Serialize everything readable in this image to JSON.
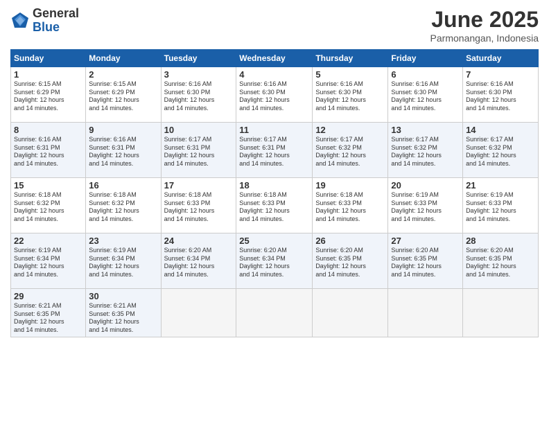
{
  "logo": {
    "general": "General",
    "blue": "Blue"
  },
  "header": {
    "month": "June 2025",
    "location": "Parmonangan, Indonesia"
  },
  "days_of_week": [
    "Sunday",
    "Monday",
    "Tuesday",
    "Wednesday",
    "Thursday",
    "Friday",
    "Saturday"
  ],
  "weeks": [
    [
      {
        "day": "1",
        "sunrise": "6:15 AM",
        "sunset": "6:29 PM",
        "daylight": "12 hours and 14 minutes."
      },
      {
        "day": "2",
        "sunrise": "6:15 AM",
        "sunset": "6:29 PM",
        "daylight": "12 hours and 14 minutes."
      },
      {
        "day": "3",
        "sunrise": "6:16 AM",
        "sunset": "6:30 PM",
        "daylight": "12 hours and 14 minutes."
      },
      {
        "day": "4",
        "sunrise": "6:16 AM",
        "sunset": "6:30 PM",
        "daylight": "12 hours and 14 minutes."
      },
      {
        "day": "5",
        "sunrise": "6:16 AM",
        "sunset": "6:30 PM",
        "daylight": "12 hours and 14 minutes."
      },
      {
        "day": "6",
        "sunrise": "6:16 AM",
        "sunset": "6:30 PM",
        "daylight": "12 hours and 14 minutes."
      },
      {
        "day": "7",
        "sunrise": "6:16 AM",
        "sunset": "6:30 PM",
        "daylight": "12 hours and 14 minutes."
      }
    ],
    [
      {
        "day": "8",
        "sunrise": "6:16 AM",
        "sunset": "6:31 PM",
        "daylight": "12 hours and 14 minutes."
      },
      {
        "day": "9",
        "sunrise": "6:16 AM",
        "sunset": "6:31 PM",
        "daylight": "12 hours and 14 minutes."
      },
      {
        "day": "10",
        "sunrise": "6:17 AM",
        "sunset": "6:31 PM",
        "daylight": "12 hours and 14 minutes."
      },
      {
        "day": "11",
        "sunrise": "6:17 AM",
        "sunset": "6:31 PM",
        "daylight": "12 hours and 14 minutes."
      },
      {
        "day": "12",
        "sunrise": "6:17 AM",
        "sunset": "6:32 PM",
        "daylight": "12 hours and 14 minutes."
      },
      {
        "day": "13",
        "sunrise": "6:17 AM",
        "sunset": "6:32 PM",
        "daylight": "12 hours and 14 minutes."
      },
      {
        "day": "14",
        "sunrise": "6:17 AM",
        "sunset": "6:32 PM",
        "daylight": "12 hours and 14 minutes."
      }
    ],
    [
      {
        "day": "15",
        "sunrise": "6:18 AM",
        "sunset": "6:32 PM",
        "daylight": "12 hours and 14 minutes."
      },
      {
        "day": "16",
        "sunrise": "6:18 AM",
        "sunset": "6:32 PM",
        "daylight": "12 hours and 14 minutes."
      },
      {
        "day": "17",
        "sunrise": "6:18 AM",
        "sunset": "6:33 PM",
        "daylight": "12 hours and 14 minutes."
      },
      {
        "day": "18",
        "sunrise": "6:18 AM",
        "sunset": "6:33 PM",
        "daylight": "12 hours and 14 minutes."
      },
      {
        "day": "19",
        "sunrise": "6:18 AM",
        "sunset": "6:33 PM",
        "daylight": "12 hours and 14 minutes."
      },
      {
        "day": "20",
        "sunrise": "6:19 AM",
        "sunset": "6:33 PM",
        "daylight": "12 hours and 14 minutes."
      },
      {
        "day": "21",
        "sunrise": "6:19 AM",
        "sunset": "6:33 PM",
        "daylight": "12 hours and 14 minutes."
      }
    ],
    [
      {
        "day": "22",
        "sunrise": "6:19 AM",
        "sunset": "6:34 PM",
        "daylight": "12 hours and 14 minutes."
      },
      {
        "day": "23",
        "sunrise": "6:19 AM",
        "sunset": "6:34 PM",
        "daylight": "12 hours and 14 minutes."
      },
      {
        "day": "24",
        "sunrise": "6:20 AM",
        "sunset": "6:34 PM",
        "daylight": "12 hours and 14 minutes."
      },
      {
        "day": "25",
        "sunrise": "6:20 AM",
        "sunset": "6:34 PM",
        "daylight": "12 hours and 14 minutes."
      },
      {
        "day": "26",
        "sunrise": "6:20 AM",
        "sunset": "6:35 PM",
        "daylight": "12 hours and 14 minutes."
      },
      {
        "day": "27",
        "sunrise": "6:20 AM",
        "sunset": "6:35 PM",
        "daylight": "12 hours and 14 minutes."
      },
      {
        "day": "28",
        "sunrise": "6:20 AM",
        "sunset": "6:35 PM",
        "daylight": "12 hours and 14 minutes."
      }
    ],
    [
      {
        "day": "29",
        "sunrise": "6:21 AM",
        "sunset": "6:35 PM",
        "daylight": "12 hours and 14 minutes."
      },
      {
        "day": "30",
        "sunrise": "6:21 AM",
        "sunset": "6:35 PM",
        "daylight": "12 hours and 14 minutes."
      },
      null,
      null,
      null,
      null,
      null
    ]
  ],
  "labels": {
    "sunrise": "Sunrise:",
    "sunset": "Sunset:",
    "daylight": "Daylight:"
  }
}
